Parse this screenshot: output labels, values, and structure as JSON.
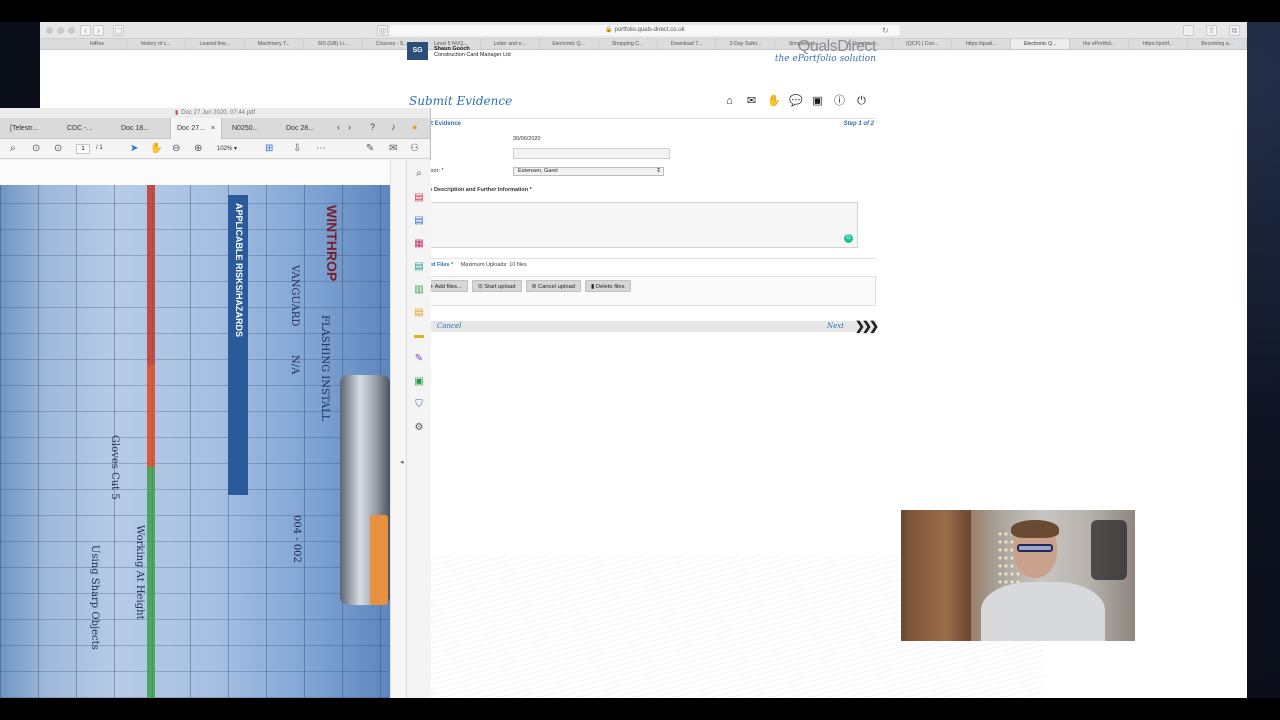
{
  "browser": {
    "url": "portfolio.quals-direct.co.uk",
    "tabs": [
      "HiRes",
      "history of c...",
      "Leased line...",
      "Machinery T...",
      "SIS (GB) Li...",
      "Courses - S...",
      "Level 5 NVQ...",
      "Letter and e...",
      "Electronic Q...",
      "Shopping C...",
      "Download 7...",
      "2-Day Safet...",
      "Simpleduck...",
      "6 Construct...",
      "(QCF) | Con...",
      "https://quali...",
      "Electronic Q...",
      "the ePortfoli...",
      "https://portf...",
      "Becoming a..."
    ]
  },
  "qd": {
    "logo_initials": "SG",
    "user_name": "Shaun Gooch",
    "user_role": "Construction Card Manager Ltd",
    "brand_name": "QualsDirect",
    "brand_tagline": "the ePortfolio solution",
    "page_title": "Submit Evidence",
    "section_label": "t Evidence",
    "step": "Step 1 of 2",
    "date_value": "30/06/2020",
    "title_label": "*",
    "assessor_label": "essor: *",
    "assessor_value": "Estensen, Garet",
    "desc_label": "nce Description and Further Information *",
    "files_label": "ed Files *",
    "max_uploads": "Maximum Uploads: 10 files",
    "btn_add": "Add files...",
    "btn_start": "Start upload",
    "btn_cancel_upload": "Cancel upload",
    "btn_delete": "Delete files",
    "footer_cancel": "Cancel",
    "footer_next": "Next"
  },
  "pdf": {
    "title": "Doc 27 Jun 2020, 07:44.pdf",
    "tabs": [
      "[Telestr...",
      "CDC -...",
      "Doc 18...",
      "Doc 27...",
      "N0250...",
      "Doc 28..."
    ],
    "page_current": "1",
    "page_total": "/ 1",
    "zoom": "102%",
    "doc_brand": "WINTHROP",
    "doc_section": "APPLICABLE RISKS/HAZARDS",
    "hand_1": "FLASHING INSTALL",
    "hand_2": "VANGUARD",
    "hand_3": "N/A",
    "hand_4": "004 - 002",
    "hand_5": "Working At Height",
    "hand_6": "Using Sharp Objects",
    "hand_7": "Gloves Cut 5"
  }
}
